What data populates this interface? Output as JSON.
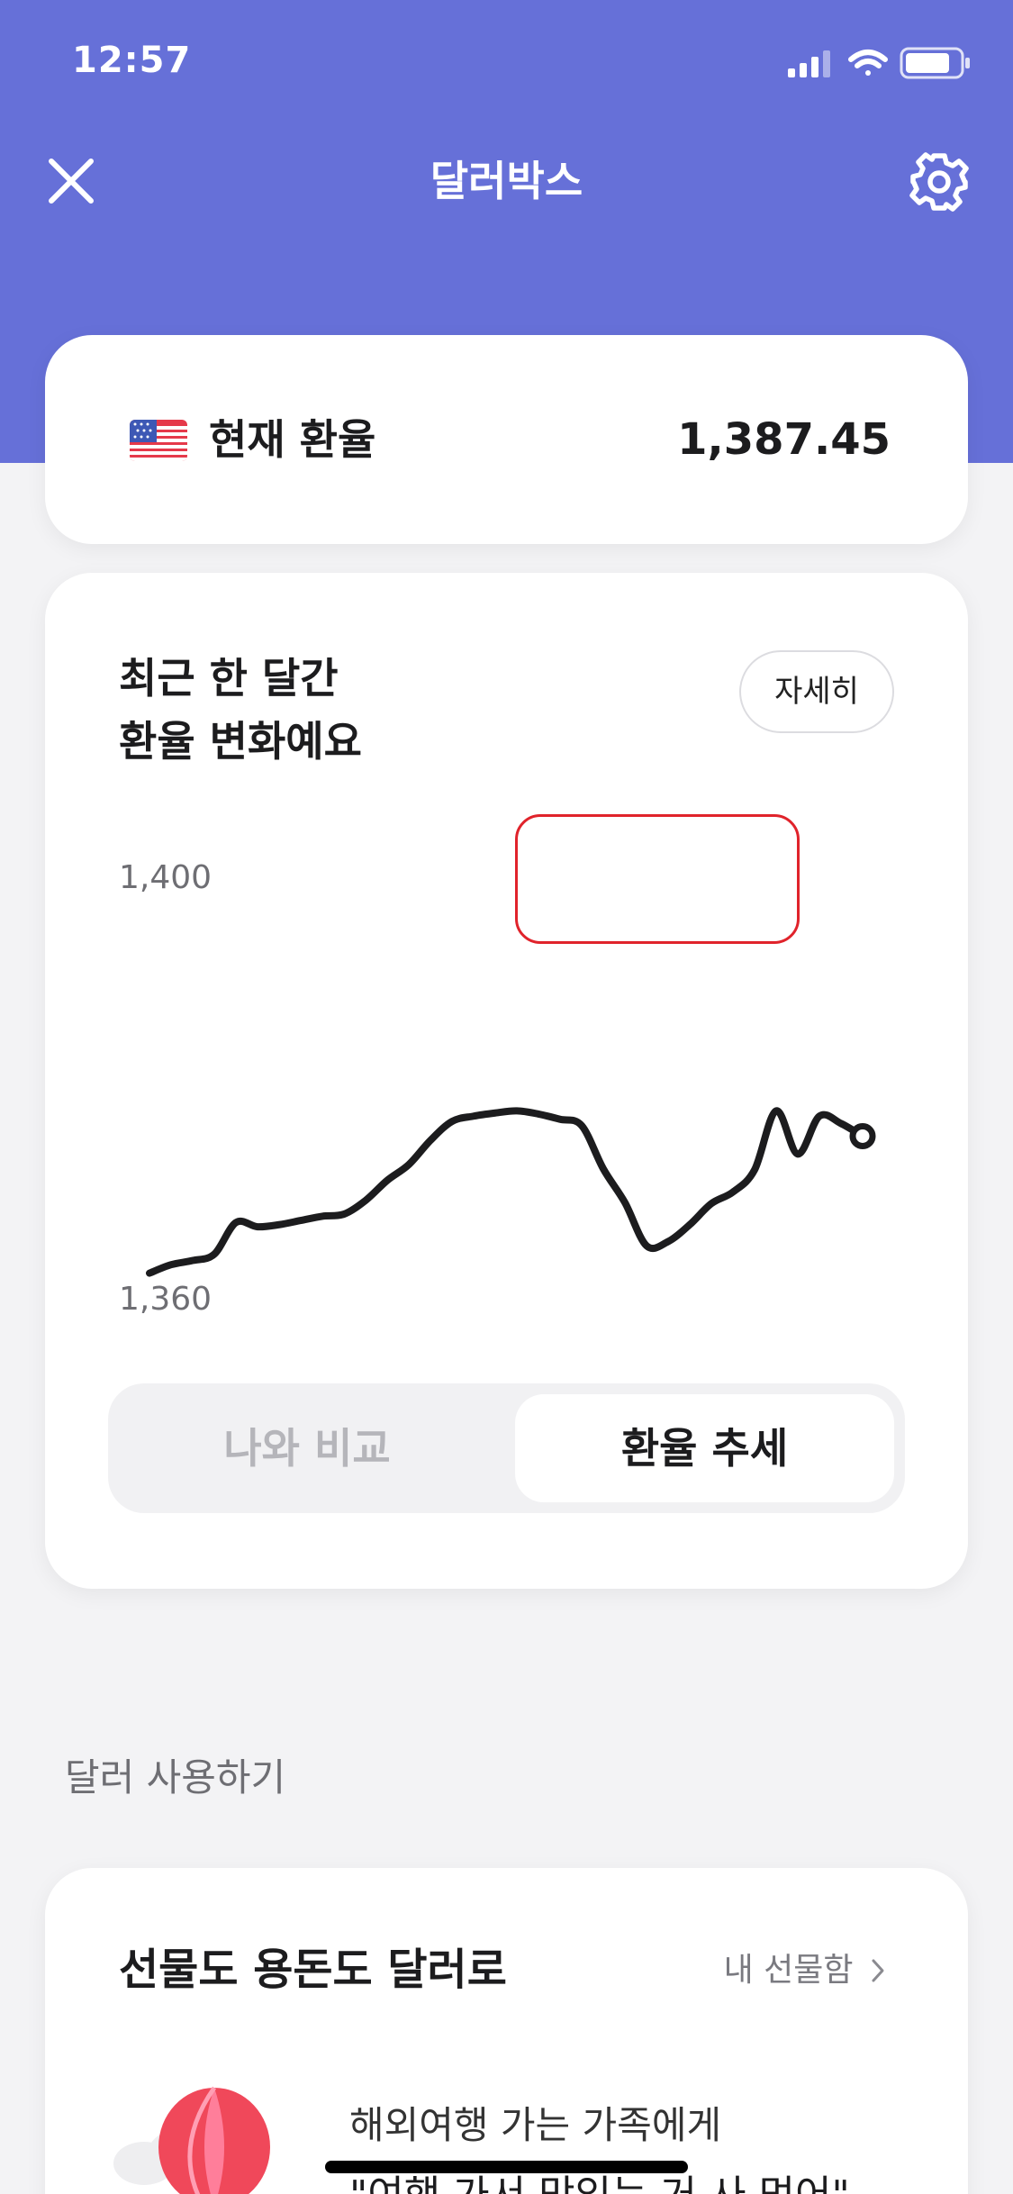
{
  "status_bar": {
    "time": "12:57"
  },
  "header": {
    "title": "달러박스"
  },
  "rate_card": {
    "label": "현재 환율",
    "value": "1,387.45"
  },
  "chart_card": {
    "title_line1": "최근 한 달간",
    "title_line2": "환율 변화예요",
    "detail_button": "자세히",
    "segments": {
      "left": "나와 비교",
      "right": "환율 추세",
      "selected": "right"
    }
  },
  "chart_data": {
    "type": "line",
    "title": "최근 한 달간 환율 변화예요",
    "xlabel": "",
    "ylabel": "",
    "ylim": [
      1360,
      1400
    ],
    "y_tick_labels": [
      "1,400",
      "1,360"
    ],
    "grid": false,
    "series": [
      {
        "values": [
          1362.6,
          1363.4,
          1363.8,
          1364.4,
          1367.4,
          1367.0,
          1367.2,
          1367.6,
          1368.0,
          1368.2,
          1369.5,
          1371.4,
          1372.9,
          1375.2,
          1377.0,
          1377.5,
          1377.8,
          1378.0,
          1377.7,
          1377.2,
          1376.6,
          1372.5,
          1369.3,
          1365.2,
          1365.6,
          1367.2,
          1369.2,
          1370.3,
          1372.4,
          1378.0,
          1373.9,
          1377.5,
          1376.8,
          1375.6
        ]
      }
    ]
  },
  "section": {
    "use_dollars_label": "달러 사용하기"
  },
  "gift_card": {
    "title": "선물도 용돈도 달러로",
    "link": "내 선물함",
    "subtitle": "해외여행 가는 가족에게",
    "quote": "\"여행 가서 맛있는 거 사 먹어\""
  },
  "colors": {
    "brand": "#6670d8",
    "background": "#f3f3f5",
    "line": "#1c1c1e",
    "highlight": "#e0232b"
  },
  "icons": [
    "close-icon",
    "gear-icon",
    "us-flag-icon",
    "chevron-right-icon",
    "balloon-icon"
  ]
}
